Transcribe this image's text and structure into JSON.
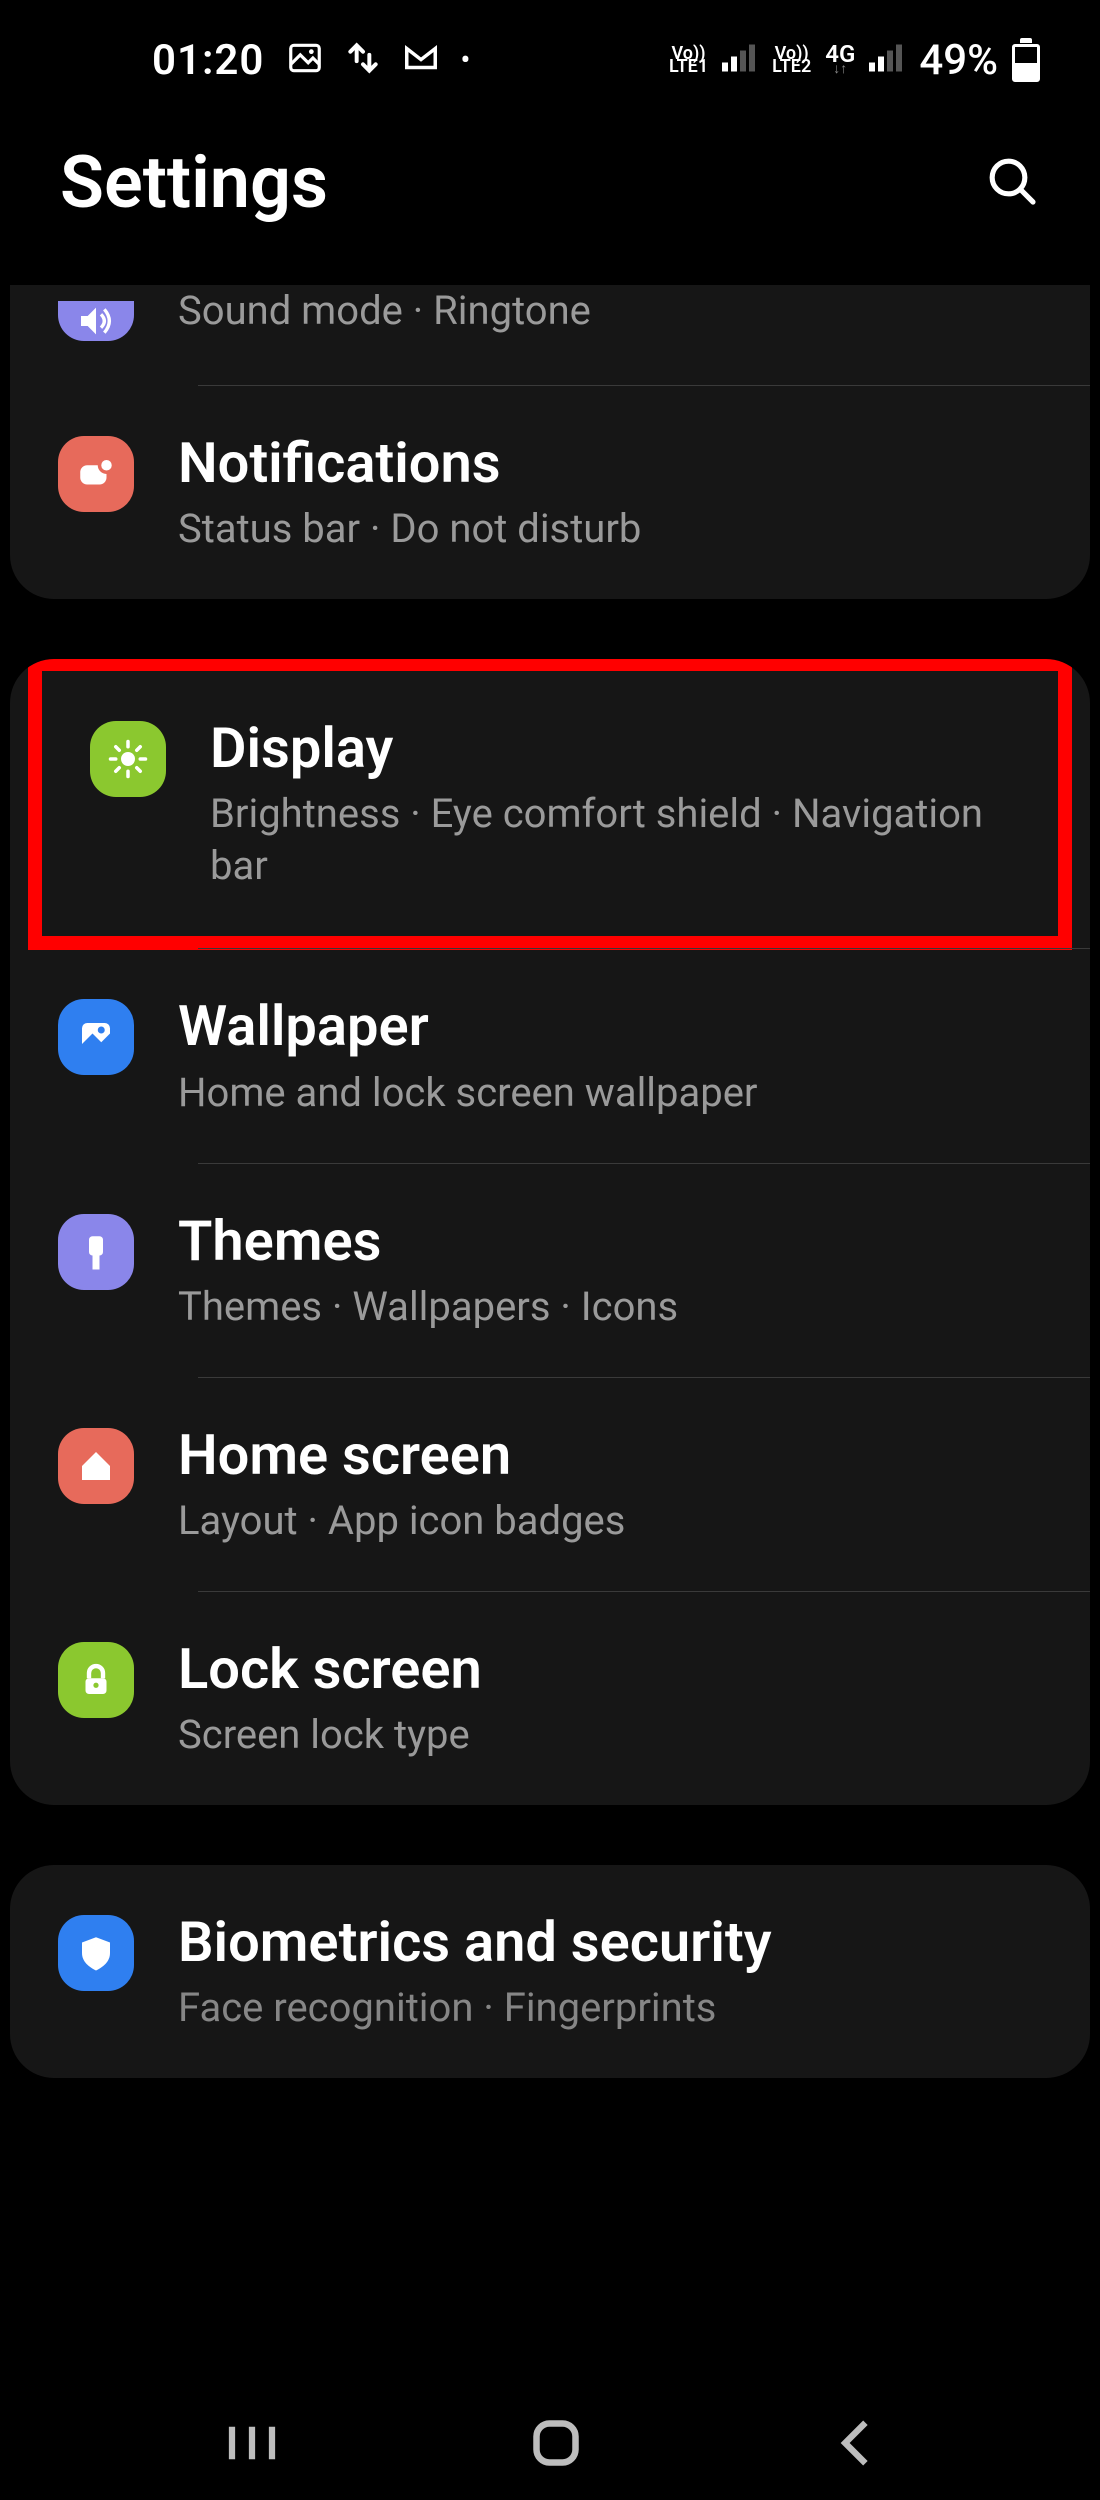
{
  "status": {
    "time": "01:20",
    "sim1_top": "Vo))",
    "sim1_bot": "LTE1",
    "sim2_top": "Vo))",
    "sim2_bot": "LTE2",
    "net": "4G",
    "battery": "49%"
  },
  "header": {
    "title": "Settings"
  },
  "items": {
    "sound_sub": "Sound mode  ·  Ringtone",
    "notifications_title": "Notifications",
    "notifications_sub": "Status bar  ·  Do not disturb",
    "display_title": "Display",
    "display_sub": "Brightness  ·  Eye comfort shield  ·  Navigation bar",
    "wallpaper_title": "Wallpaper",
    "wallpaper_sub": "Home and lock screen wallpaper",
    "themes_title": "Themes",
    "themes_sub": "Themes  ·  Wallpapers  ·  Icons",
    "home_title": "Home screen",
    "home_sub": "Layout  ·  App icon badges",
    "lock_title": "Lock screen",
    "lock_sub": "Screen lock type",
    "biometrics_title": "Biometrics and security",
    "biometrics_sub": "Face recognition  ·  Fingerprints"
  }
}
